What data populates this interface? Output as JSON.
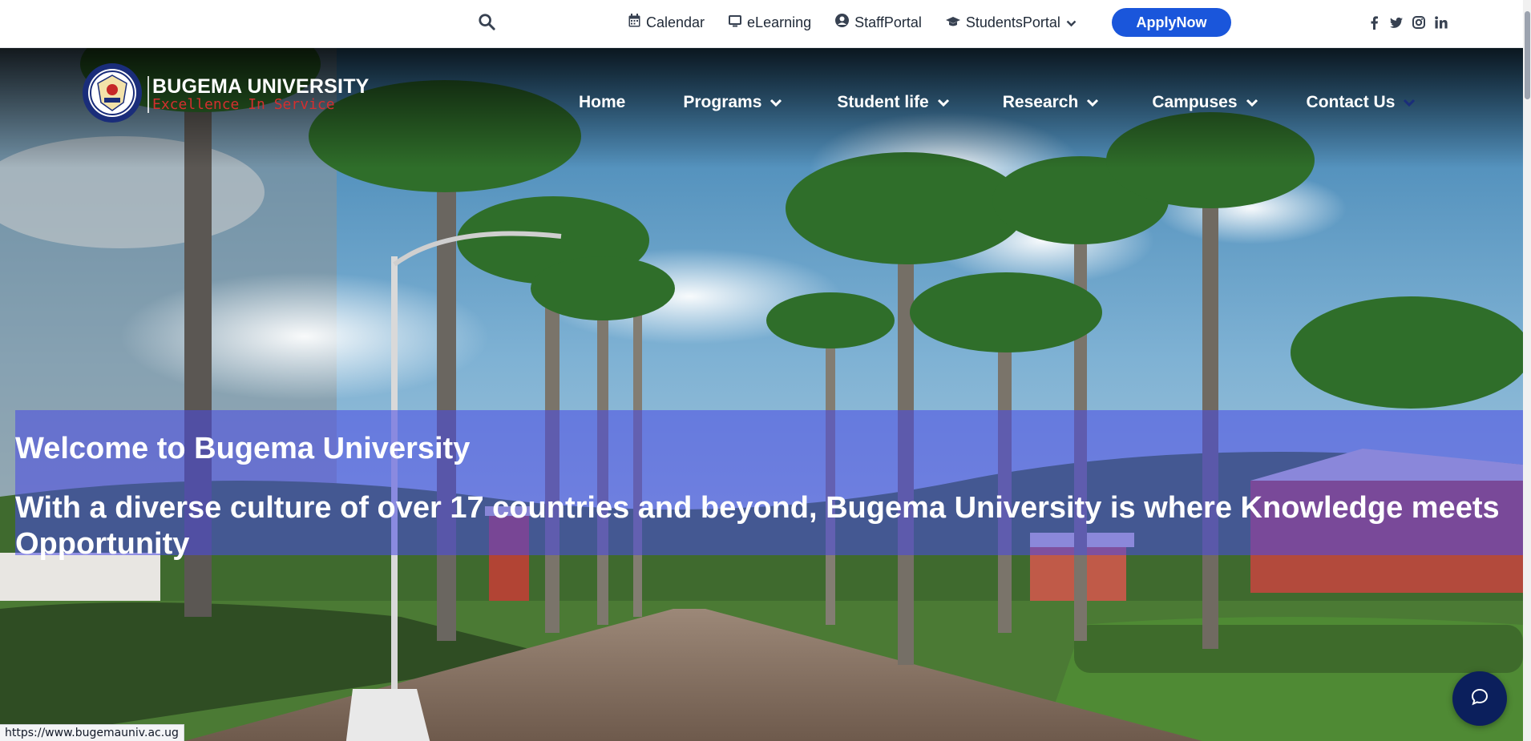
{
  "topbar": {
    "search_icon": "search-icon",
    "links": [
      {
        "label": "Calendar",
        "icon": "calendar-icon"
      },
      {
        "label": "eLearning",
        "icon": "monitor-icon"
      },
      {
        "label": "StaffPortal",
        "icon": "user-circle-icon"
      },
      {
        "label": "StudentsPortal",
        "icon": "graduation-cap-icon",
        "dropdown": true
      }
    ],
    "apply_label": "ApplyNow",
    "apply_color": "#1a56db",
    "socials": [
      "facebook-icon",
      "twitter-icon",
      "instagram-icon",
      "linkedin-icon"
    ]
  },
  "logo": {
    "name": "BUGEMA UNIVERSITY",
    "tagline": "Excellence In Service",
    "tagline_color": "#d32f2f"
  },
  "nav": {
    "home": "Home",
    "programs": "Programs",
    "student_life": "Student life",
    "research": "Research",
    "campuses": "Campuses",
    "contact": "Contact Us"
  },
  "hero": {
    "title": "Welcome to Bugema University",
    "subtitle": "With a diverse culture of over 17 countries and beyond, Bugema University is where Knowledge meets Opportunity",
    "banner_color": "#4848e6"
  },
  "chat": {
    "icon": "chat-bubble-icon",
    "color": "#0b1f5c"
  },
  "status_bar": {
    "url": "https://www.bugemauniv.ac.ug"
  }
}
